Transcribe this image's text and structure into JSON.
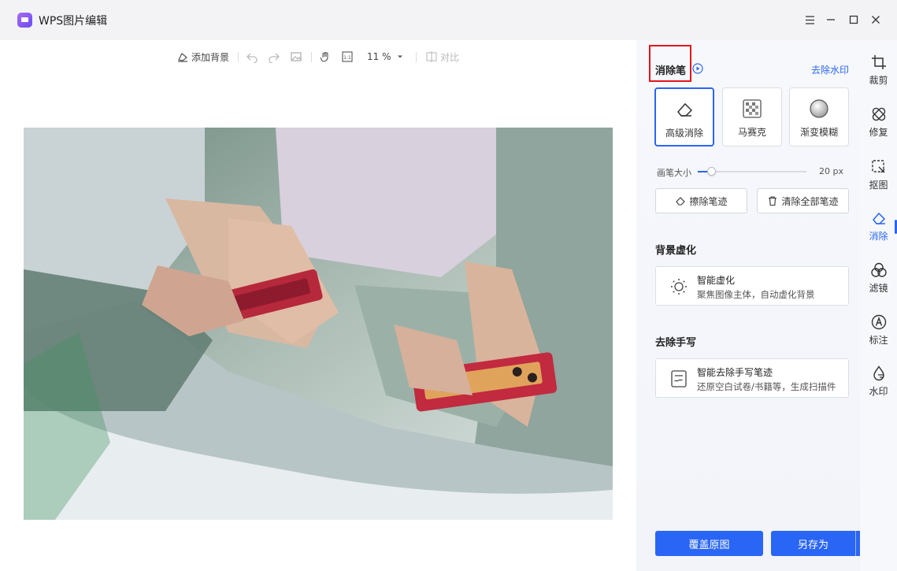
{
  "window": {
    "title": "WPS图片编辑"
  },
  "toolbar": {
    "add_background": "添加背景",
    "zoom": "11 %",
    "compare": "对比"
  },
  "eraser": {
    "title": "消除笔",
    "remove_watermark_link": "去除水印",
    "tools": [
      {
        "label": "高级消除",
        "icon": "eraser-icon",
        "selected": true
      },
      {
        "label": "马赛克",
        "icon": "mosaic-icon",
        "selected": false
      },
      {
        "label": "渐变模糊",
        "icon": "gradient-blur-icon",
        "selected": false
      }
    ],
    "brush_size_label": "画笔大小",
    "brush_size_value": "20 px",
    "brush_size_fraction": 0.13,
    "erase_strokes": "擦除笔迹",
    "clear_all_strokes": "清除全部笔迹"
  },
  "background_blur": {
    "title": "背景虚化",
    "feature_title": "智能虚化",
    "feature_desc": "聚焦图像主体，自动虚化背景"
  },
  "remove_handwriting": {
    "title": "去除手写",
    "feature_title": "智能去除手写笔迹",
    "feature_desc": "还原空白试卷/书籍等，生成扫描件"
  },
  "rail": {
    "items": [
      {
        "label": "裁剪",
        "icon": "crop-icon"
      },
      {
        "label": "修复",
        "icon": "repair-icon"
      },
      {
        "label": "抠图",
        "icon": "cutout-icon"
      },
      {
        "label": "消除",
        "icon": "eraser-icon",
        "active": true
      },
      {
        "label": "滤镜",
        "icon": "filter-icon"
      },
      {
        "label": "标注",
        "icon": "annotate-icon"
      },
      {
        "label": "水印",
        "icon": "watermark-icon"
      }
    ]
  },
  "footer": {
    "overwrite_original": "覆盖原图",
    "save_as": "另存为"
  },
  "colors": {
    "accent": "#2a66f5",
    "highlight_box": "#e3151a"
  }
}
